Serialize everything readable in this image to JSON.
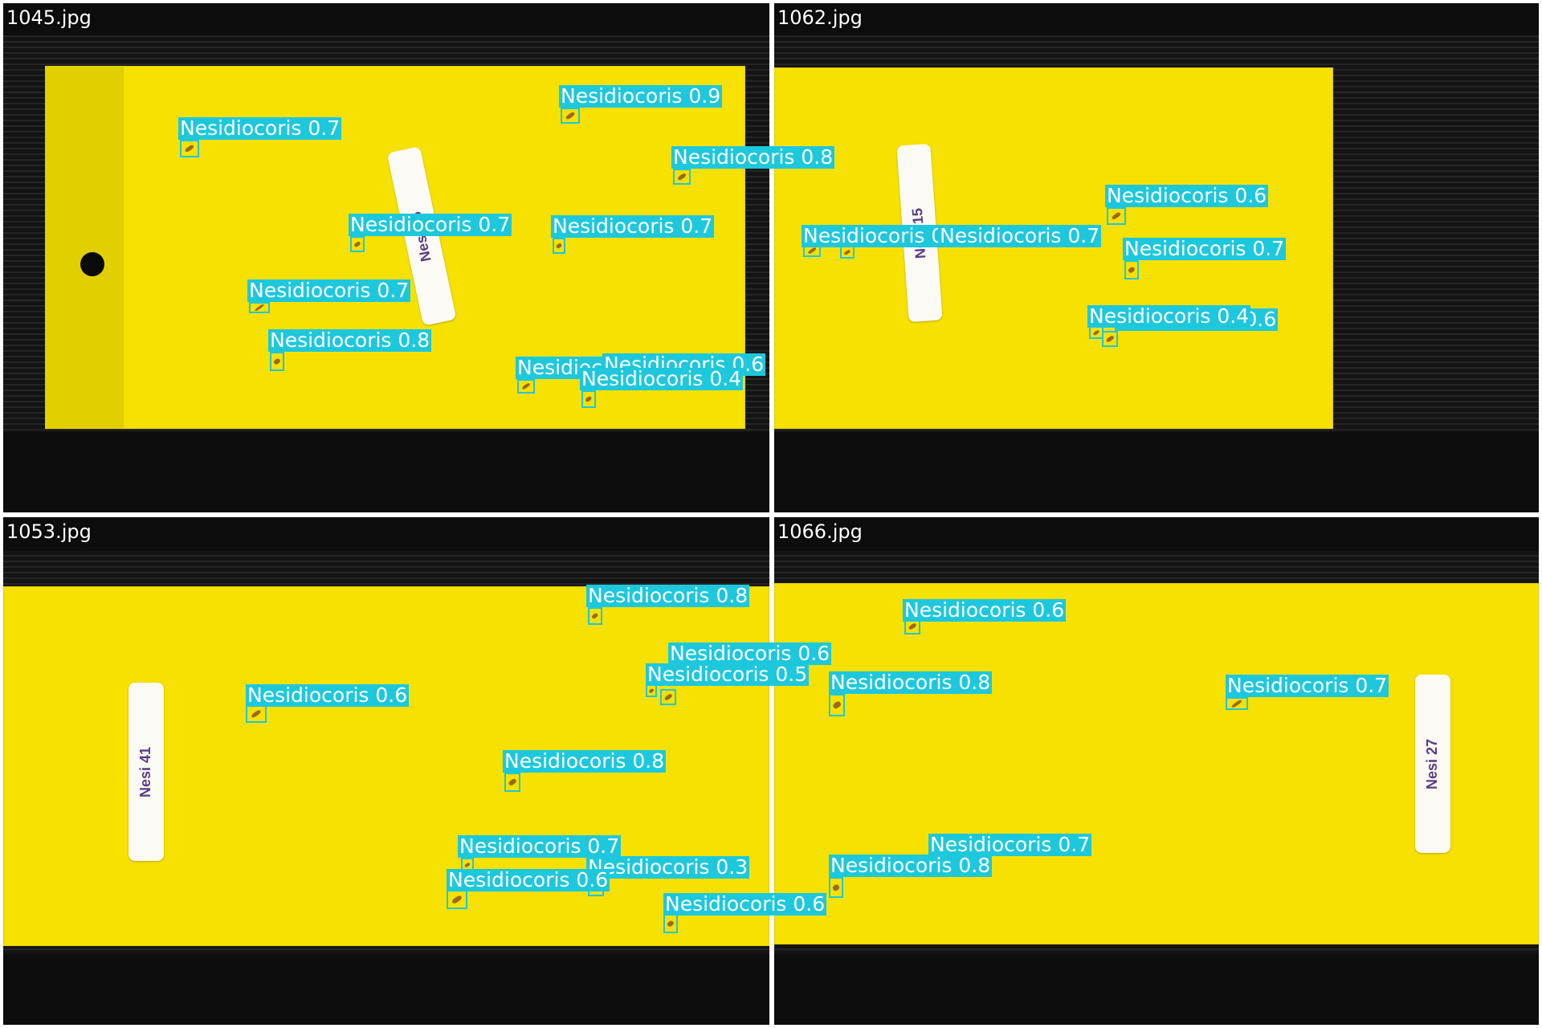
{
  "tiles": [
    {
      "filename": "1045.jpg",
      "sticker": "Nesi 16",
      "detections": [
        {
          "label": "Nesidiocoris 0.7"
        },
        {
          "label": "Nesidiocoris 0.9"
        },
        {
          "label": "Nesidiocoris 0.8"
        },
        {
          "label": "Nesidiocoris 0.7"
        },
        {
          "label": "Nesidiocoris 0.7"
        },
        {
          "label": "Nesidiocoris 0.7"
        },
        {
          "label": "Nesidiocoris 0.8"
        },
        {
          "label": "Nesidiocoris 0.6"
        },
        {
          "label": "Nesidiocoris 0.6"
        },
        {
          "label": "Nesidiocoris 0.4"
        }
      ]
    },
    {
      "filename": "1062.jpg",
      "sticker": "Nesi 15",
      "detections": [
        {
          "label": "Nesidiocoris 0.6"
        },
        {
          "label": "Nesidiocoris 0.7"
        },
        {
          "label": "Nesidiocoris 0.6"
        },
        {
          "label": "Nesidiocoris 0.7"
        },
        {
          "label": "Nesidiocoris 0.6"
        },
        {
          "label": "Nesidiocoris 0.4"
        }
      ]
    },
    {
      "filename": "1053.jpg",
      "sticker": "Nesi 41",
      "detections": [
        {
          "label": "Nesidiocoris 0.8"
        },
        {
          "label": "Nesidiocoris 0.6"
        },
        {
          "label": "Nesidiocoris 0.5"
        },
        {
          "label": "Nesidiocoris 0.6"
        },
        {
          "label": "Nesidiocoris 0.8"
        },
        {
          "label": "Nesidiocoris 0.7"
        },
        {
          "label": "Nesidiocoris 0.3"
        },
        {
          "label": "Nesidiocoris 0.6"
        },
        {
          "label": "Nesidiocoris 0.6"
        }
      ]
    },
    {
      "filename": "1066.jpg",
      "sticker": "Nesi 27",
      "detections": [
        {
          "label": "Nesidiocoris 0.6"
        },
        {
          "label": "Nesidiocoris 0.8"
        },
        {
          "label": "Nesidiocoris 0.7"
        },
        {
          "label": "Nesidiocoris 0.7"
        },
        {
          "label": "Nesidiocoris 0.8"
        }
      ]
    }
  ],
  "colors": {
    "trap_yellow": "#f6e100",
    "detection_cyan": "#1ec8dc",
    "sticker_text": "#5a3a86"
  }
}
